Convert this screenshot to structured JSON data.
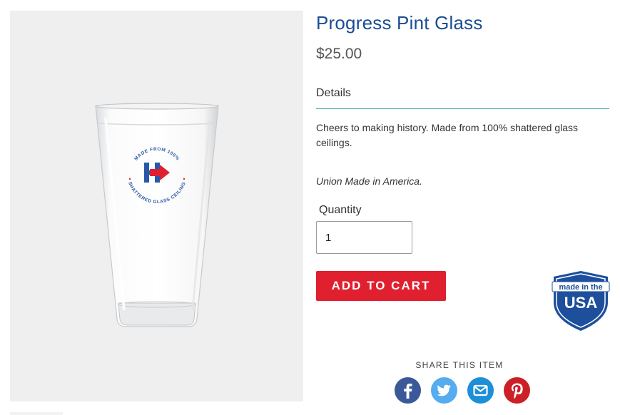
{
  "product": {
    "title": "Progress Pint Glass",
    "price": "$25.00",
    "details_heading": "Details",
    "description": "Cheers to making history. Made from 100% shattered glass ceilings.",
    "union_note": "Union Made in America.",
    "quantity_label": "Quantity",
    "quantity_value": "1",
    "add_to_cart_label": "ADD TO CART",
    "glass_logo_text": "MADE FROM 100% SHATTERED GLASS CEILING"
  },
  "badge": {
    "line1": "made in the",
    "line2": "USA"
  },
  "share": {
    "label": "SHARE THIS ITEM",
    "icons": [
      "facebook-icon",
      "twitter-icon",
      "email-icon",
      "pinterest-icon"
    ]
  },
  "colors": {
    "title_blue": "#1a4d93",
    "cart_red": "#e0202f",
    "rule_teal": "#3aa5b3",
    "facebook": "#3b5998",
    "twitter": "#55acee",
    "email": "#1d8fd6",
    "pinterest": "#cb2027"
  }
}
